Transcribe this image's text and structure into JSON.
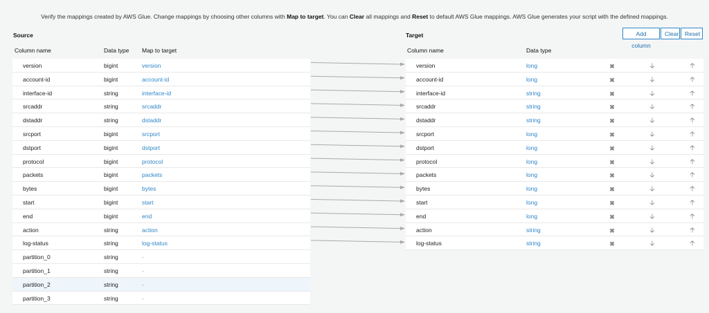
{
  "intro": {
    "t1": "Verify the mappings created by AWS Glue. Change mappings by choosing other columns with ",
    "b1": "Map to target",
    "t2": ". You can ",
    "b2": "Clear",
    "t3": " all mappings and ",
    "b3": "Reset",
    "t4": " to default AWS Glue mappings. AWS Glue generates your script with the defined mappings."
  },
  "source": {
    "label": "Source",
    "headers": {
      "column": "Column name",
      "type": "Data type",
      "map": "Map to target"
    },
    "rows": [
      {
        "name": "version",
        "type": "bigint",
        "map": "version"
      },
      {
        "name": "account-id",
        "type": "bigint",
        "map": "account-id"
      },
      {
        "name": "interface-id",
        "type": "string",
        "map": "interface-id"
      },
      {
        "name": "srcaddr",
        "type": "string",
        "map": "srcaddr"
      },
      {
        "name": "dstaddr",
        "type": "string",
        "map": "dstaddr"
      },
      {
        "name": "srcport",
        "type": "bigint",
        "map": "srcport"
      },
      {
        "name": "dstport",
        "type": "bigint",
        "map": "dstport"
      },
      {
        "name": "protocol",
        "type": "bigint",
        "map": "protocol"
      },
      {
        "name": "packets",
        "type": "bigint",
        "map": "packets"
      },
      {
        "name": "bytes",
        "type": "bigint",
        "map": "bytes"
      },
      {
        "name": "start",
        "type": "bigint",
        "map": "start"
      },
      {
        "name": "end",
        "type": "bigint",
        "map": "end"
      },
      {
        "name": "action",
        "type": "string",
        "map": "action"
      },
      {
        "name": "log-status",
        "type": "string",
        "map": "log-status"
      },
      {
        "name": "partition_0",
        "type": "string",
        "map": "-"
      },
      {
        "name": "partition_1",
        "type": "string",
        "map": "-"
      },
      {
        "name": "partition_2",
        "type": "string",
        "map": "-"
      },
      {
        "name": "partition_3",
        "type": "string",
        "map": "-"
      }
    ]
  },
  "target": {
    "label": "Target",
    "headers": {
      "column": "Column name",
      "type": "Data type"
    },
    "buttons": {
      "add": "Add column",
      "clear": "Clear",
      "reset": "Reset"
    },
    "rows": [
      {
        "name": "version",
        "type": "long"
      },
      {
        "name": "account-id",
        "type": "long"
      },
      {
        "name": "interface-id",
        "type": "string"
      },
      {
        "name": "srcaddr",
        "type": "string"
      },
      {
        "name": "dstaddr",
        "type": "string"
      },
      {
        "name": "srcport",
        "type": "long"
      },
      {
        "name": "dstport",
        "type": "long"
      },
      {
        "name": "protocol",
        "type": "long"
      },
      {
        "name": "packets",
        "type": "long"
      },
      {
        "name": "bytes",
        "type": "long"
      },
      {
        "name": "start",
        "type": "long"
      },
      {
        "name": "end",
        "type": "long"
      },
      {
        "name": "action",
        "type": "string"
      },
      {
        "name": "log-status",
        "type": "string"
      }
    ],
    "icons": {
      "remove": "remove-icon",
      "down": "move-down-icon",
      "up": "move-up-icon"
    }
  },
  "colors": {
    "link": "#2f86c9",
    "highlight_row": "#eef5fb",
    "background": "#f4f5f5"
  }
}
